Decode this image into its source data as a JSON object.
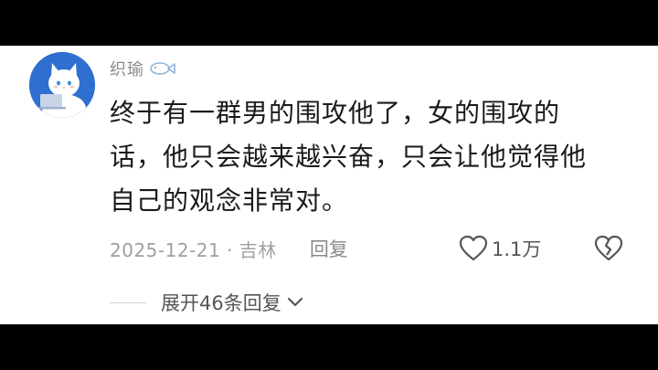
{
  "comment": {
    "username": "织瑜",
    "badge_icon": "fish-icon",
    "text_lines": [
      "终于有一群男的围攻他了，女的围攻的",
      "话，他只会越来越兴奋，只会让他觉得他",
      "自己的观念非常对。"
    ],
    "date_location": "2025-12-21 · 吉林",
    "reply_label": "回复",
    "like_count": "1.1万",
    "expand_replies_label": "展开46条回复"
  },
  "colors": {
    "background_bar": "#000000",
    "card": "#ffffff",
    "text": "#1a1a1a",
    "muted": "#a0a0a0",
    "avatar_bg": "#2f6fcf"
  }
}
